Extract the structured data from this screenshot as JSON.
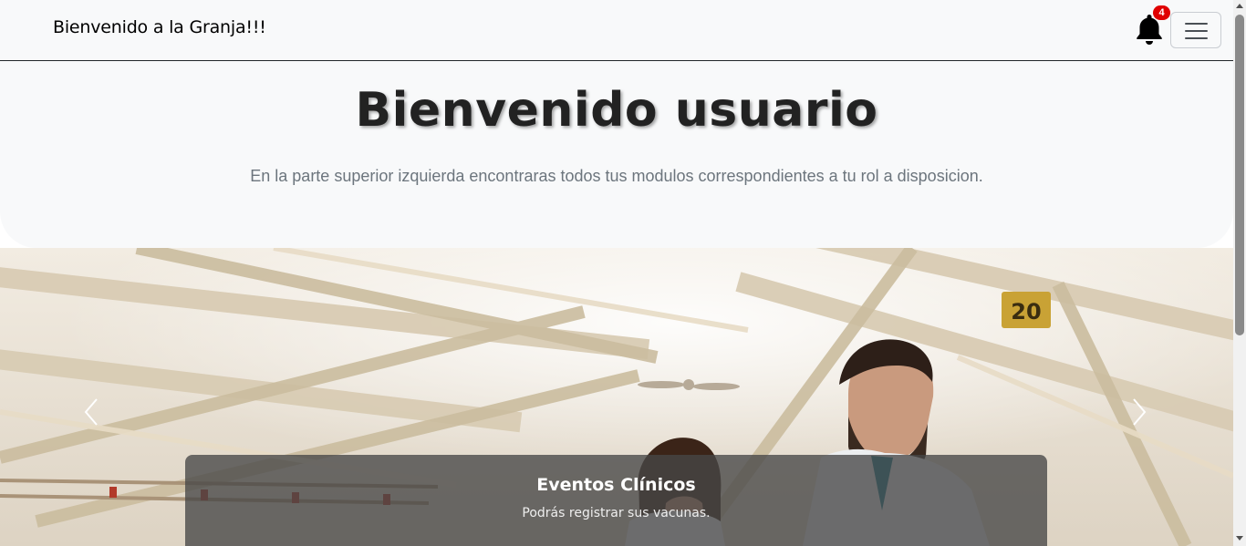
{
  "navbar": {
    "brand": "Bienvenido a la Granja!!!",
    "notifications": {
      "icon": "bell-icon",
      "count": "4"
    },
    "menu_toggle_icon": "hamburger-menu-icon"
  },
  "hero": {
    "title": "Bienvenido usuario",
    "subtitle": "En la parte superior izquierda encontraras todos tus modulos correspondientes a tu rol a disposicion."
  },
  "carousel": {
    "slide": {
      "title": "Eventos Clínicos",
      "text": "Podrás registrar sus vacunas."
    },
    "prev_icon": "chevron-left-icon",
    "next_icon": "chevron-right-icon"
  },
  "colors": {
    "navbar_bg": "#f8f9fa",
    "badge": "#e00000",
    "subtitle": "#6c757d",
    "caption_bg": "#464646"
  }
}
